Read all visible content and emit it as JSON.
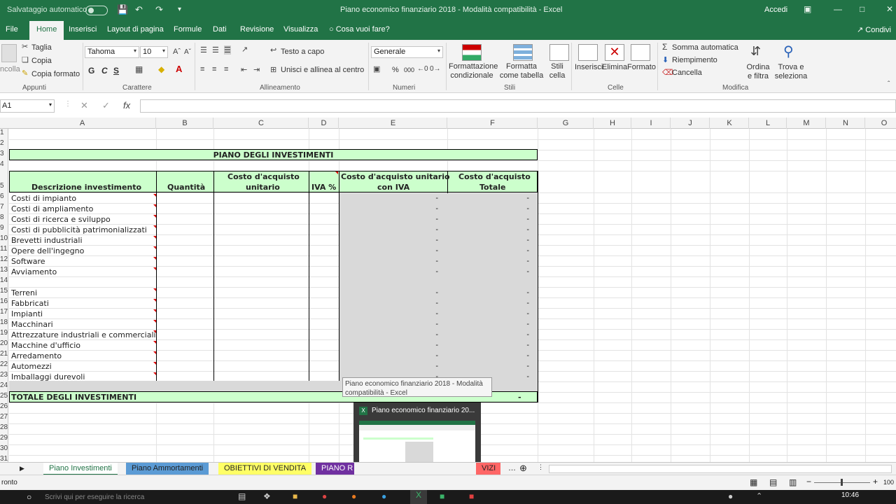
{
  "titlebar": {
    "autosave": "Salvataggio automatico",
    "title": "Piano economico finanziario 2018  -  Modalità compatibilità  -  Excel",
    "signin": "Accedi"
  },
  "tabs": {
    "file": "File",
    "home": "Home",
    "insert": "Inserisci",
    "layout": "Layout di pagina",
    "formulas": "Formule",
    "data": "Dati",
    "review": "Revisione",
    "view": "Visualizza",
    "tellme": "Cosa vuoi fare?",
    "share": "Condivi"
  },
  "ribbon": {
    "clipboard": {
      "paste": "ncolla",
      "cut": "Taglia",
      "copy": "Copia",
      "format_painter": "Copia formato",
      "group": "Appunti"
    },
    "font": {
      "name": "Tahoma",
      "size": "10",
      "bold": "G",
      "italic": "C",
      "underline": "S",
      "group": "Carattere"
    },
    "alignment": {
      "wrap": "Testo a capo",
      "merge": "Unisci e allinea al centro",
      "group": "Allineamento"
    },
    "number": {
      "format": "Generale",
      "percent": "%",
      "thousands": "000",
      "group": "Numeri"
    },
    "styles": {
      "conditional": "Formattazione condizionale",
      "as_table": "Formatta come tabella",
      "cell_styles": "Stili cella",
      "group": "Stili"
    },
    "cells": {
      "insert": "Inserisci",
      "delete": "Elimina",
      "format": "Formato",
      "group": "Celle"
    },
    "editing": {
      "autosum": "Somma automatica",
      "fill": "Riempimento",
      "clear": "Cancella",
      "sort": "Ordina e filtra",
      "find": "Trova e seleziona",
      "group": "Modifica"
    }
  },
  "formula_bar": {
    "name_box": "A1",
    "formula": ""
  },
  "columns": [
    "A",
    "B",
    "C",
    "D",
    "E",
    "F",
    "G",
    "H",
    "I",
    "J",
    "K",
    "L",
    "M",
    "N",
    "O"
  ],
  "rows": [
    "1",
    "2",
    "3",
    "4",
    "5",
    "6",
    "7",
    "8",
    "9",
    "10",
    "11",
    "12",
    "13",
    "14",
    "15",
    "16",
    "17",
    "18",
    "19",
    "20",
    "21",
    "22",
    "23",
    "24",
    "25",
    "26",
    "27",
    "28",
    "29",
    "30",
    "31"
  ],
  "sheet": {
    "title": "PIANO DEGLI INVESTIMENTI",
    "headers": {
      "description": "Descrizione investimento",
      "quantity": "Quantità",
      "unit_cost_1": "Costo d'acquisto",
      "unit_cost_2": "unitario",
      "vat": "IVA %",
      "unit_cost_vat_1": "Costo d'acquisto  unitario",
      "unit_cost_vat_2": "con IVA",
      "total_1": "Costo d'acquisto",
      "total_2": "Totale"
    },
    "items_group1": [
      "Costi di impianto",
      "Costi di ampliamento",
      "Costi di ricerca e sviluppo",
      "Costi di pubblicità patrimonializzati",
      "Brevetti industriali",
      "Opere dell'ingegno",
      "Software",
      "Avviamento"
    ],
    "items_group2": [
      "Terreni",
      "Fabbricati",
      "Impianti",
      "Macchinari",
      "Attrezzature industriali e commerciali",
      "Macchine d'ufficio",
      "Arredamento",
      "Automezzi",
      "Imballaggi durevoli"
    ],
    "dash": "-",
    "total_label": "TOTALE DEGLI INVESTIMENTI",
    "total_value": "-"
  },
  "tooltip": {
    "line1": "Piano economico finanziario 2018  -  Modalità",
    "line2": "compatibilità - Excel"
  },
  "preview": {
    "title": "Piano economico finanziario 20..."
  },
  "sheet_tabs": [
    {
      "label": "Piano Investimenti",
      "color": "#ffffff"
    },
    {
      "label": "Piano Ammortamenti",
      "color": "#5b9bd5"
    },
    {
      "label": "OBIETTIVI DI VENDITA",
      "color": "#ffff66"
    },
    {
      "label": "PIANO R",
      "color": "#7030a0"
    },
    {
      "label": "VIZI",
      "color": "#ff6666"
    }
  ],
  "status": {
    "ready": "ronto",
    "zoom": "100",
    "clock": "10:46"
  },
  "taskbar": {
    "search": "Scrivi qui per eseguire la ricerca"
  },
  "colors": {
    "excel_green": "#217346",
    "header_fill": "#ccffcc",
    "formula_fill": "#d9d9d9"
  }
}
